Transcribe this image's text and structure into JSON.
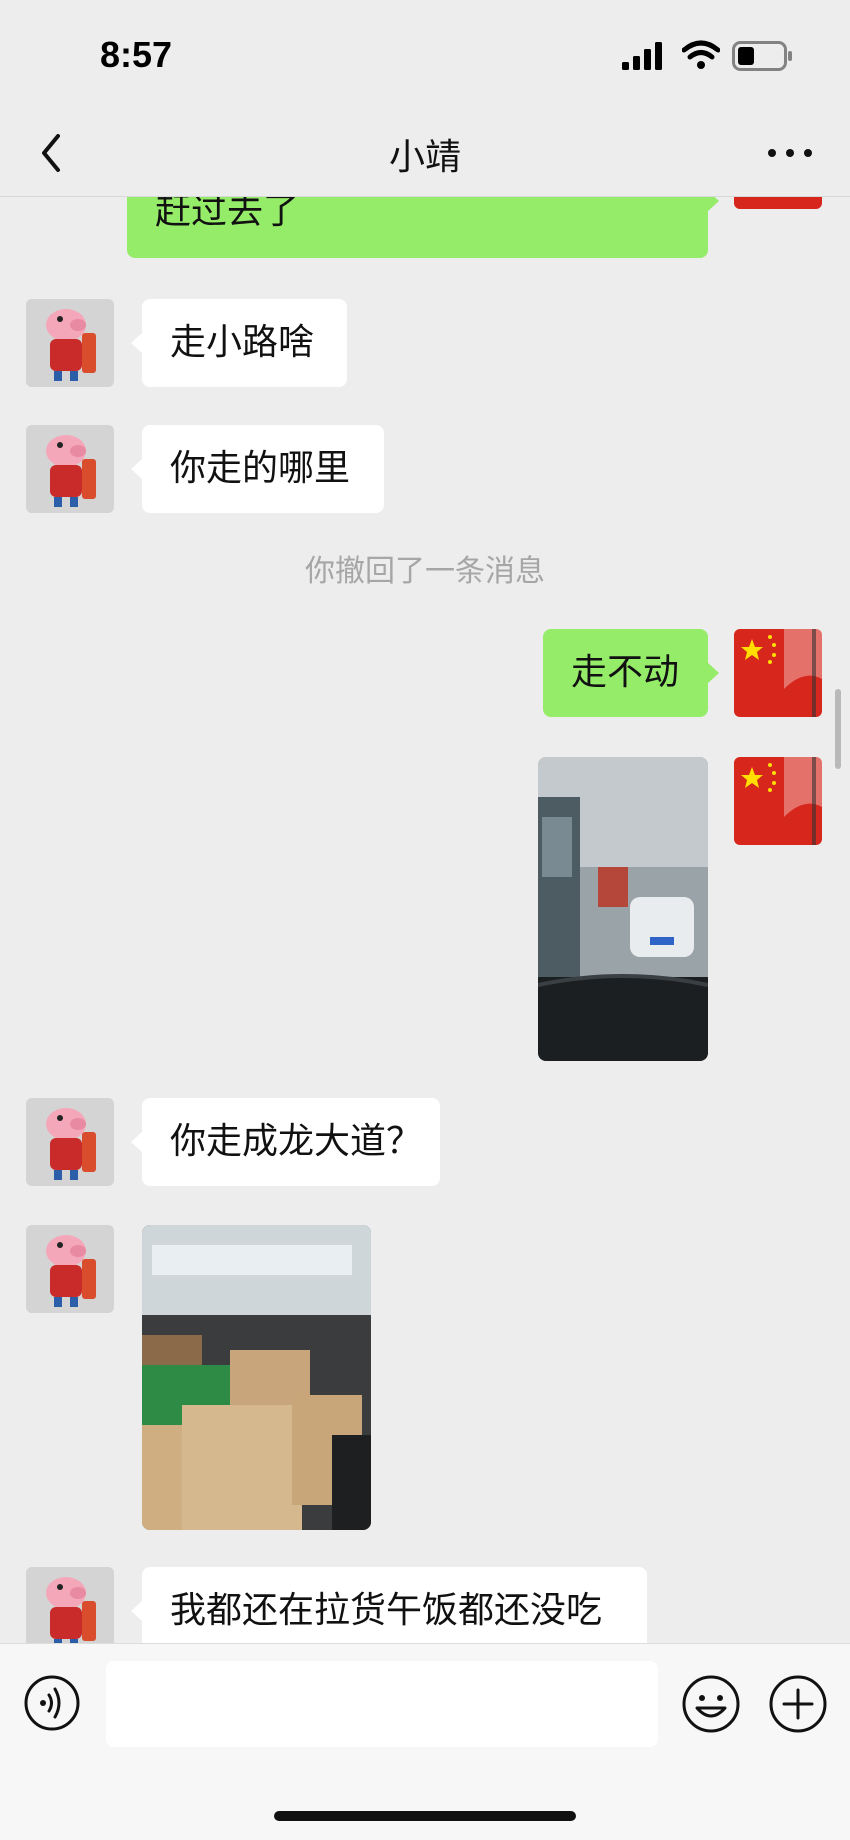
{
  "status_bar": {
    "time": "8:57"
  },
  "header": {
    "title": "小靖"
  },
  "messages": [
    {
      "text": "赶过去了"
    },
    {
      "text": "走小路啥"
    },
    {
      "text": "你走的哪里"
    },
    {
      "text": "你撤回了一条消息"
    },
    {
      "text": "走不动"
    },
    {
      "text": "你走成龙大道？"
    },
    {
      "text": "我都还在拉货午饭都还没吃"
    }
  ],
  "input": {
    "placeholder": "",
    "value": ""
  },
  "colors": {
    "outgoing_bubble": "#95ec69",
    "incoming_bubble": "#ffffff",
    "background": "#ededed"
  },
  "icons": [
    "back-icon",
    "more-icon",
    "voice-icon",
    "emoji-icon",
    "plus-icon"
  ]
}
